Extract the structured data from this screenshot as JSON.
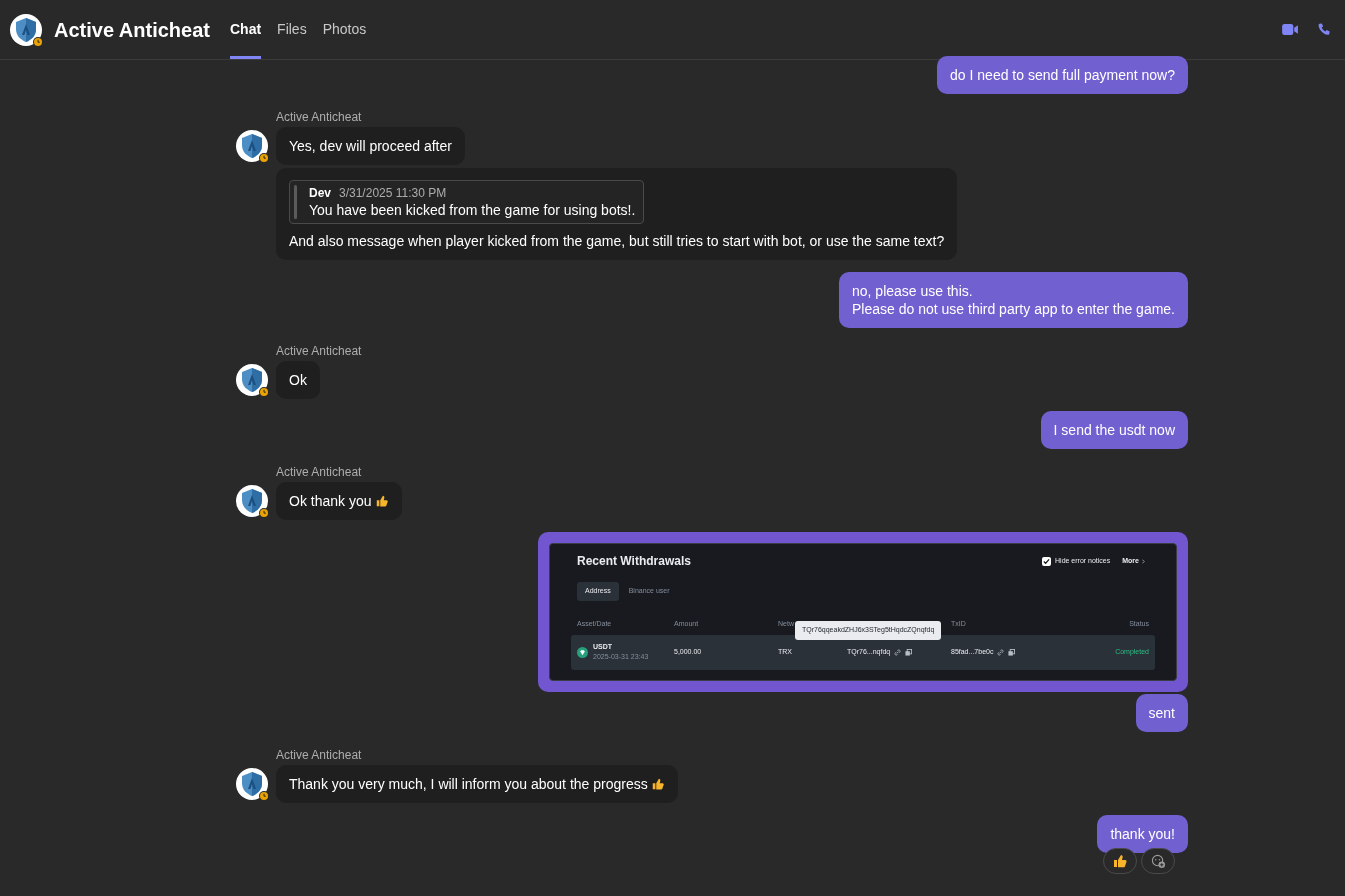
{
  "header": {
    "title": "Active Anticheat",
    "tabs": [
      {
        "label": "Chat",
        "selected": true
      },
      {
        "label": "Files",
        "selected": false
      },
      {
        "label": "Photos",
        "selected": false
      }
    ]
  },
  "messages": [
    {
      "kind": "outgoing",
      "text": "do I need to send full payment now?"
    },
    {
      "kind": "incoming",
      "sender": "Active Anticheat",
      "bubbles": [
        {
          "kind": "text",
          "text": "Yes, dev will proceed after"
        },
        {
          "kind": "quote",
          "quote": {
            "author": "Dev",
            "time": "3/31/2025 11:30 PM",
            "text": "You have been kicked from the game for using bots!."
          },
          "text": "And also message when player kicked from the game, but still tries to start with bot, or use the same text?"
        }
      ]
    },
    {
      "kind": "outgoing",
      "text": "no, please use this.\nPlease do not use third party app to enter the game."
    },
    {
      "kind": "incoming",
      "sender": "Active Anticheat",
      "bubbles": [
        {
          "kind": "text",
          "text": "Ok"
        }
      ]
    },
    {
      "kind": "outgoing",
      "text": "I send the usdt now"
    },
    {
      "kind": "incoming",
      "sender": "Active Anticheat",
      "bubbles": [
        {
          "kind": "text-thumbs-up",
          "text": "Ok thank you"
        }
      ]
    },
    {
      "kind": "screenshot",
      "screenshot": {
        "title": "Recent Withdrawals",
        "checkbox": {
          "label": "Hide error notices",
          "checked": true
        },
        "more": "More",
        "tabs": [
          {
            "label": "Address",
            "selected": true
          },
          {
            "label": "Binance user",
            "selected": false
          }
        ],
        "columns": [
          "Asset/Date",
          "Amount",
          "Netw",
          "TxID",
          "Status"
        ],
        "row": {
          "asset": "USDT",
          "date": "2025-03-31 23:43",
          "amount": "5,000.00",
          "network": "TRX",
          "address": "TQr76...nqfdq",
          "txid": "85fad...7be0c",
          "status": "Completed"
        },
        "tooltip": "TQr76qqeakdZHJ6x3STeg5tHqdcZQnqfdq"
      }
    },
    {
      "kind": "outgoing",
      "text": "sent"
    },
    {
      "kind": "incoming",
      "sender": "Active Anticheat",
      "bubbles": [
        {
          "kind": "text-thumbs-up",
          "text": "Thank you very much, I will inform you about the progress"
        }
      ]
    },
    {
      "kind": "outgoing",
      "text": "thank you!",
      "reactions": [
        {
          "kind": "thumbs-up"
        },
        {
          "kind": "add-reaction"
        }
      ]
    }
  ]
}
